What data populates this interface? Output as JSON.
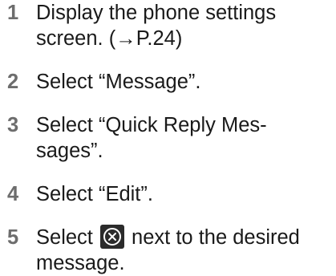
{
  "steps": [
    {
      "number": "1",
      "text_line1": "Display the phone settings",
      "text_line2": "screen. (→P.24)"
    },
    {
      "number": "2",
      "text_line1": "Select “Message”."
    },
    {
      "number": "3",
      "text_line1": "Select “Quick Reply Mes-",
      "text_line2": "sages”."
    },
    {
      "number": "4",
      "text_line1": "Select “Edit”."
    },
    {
      "number": "5",
      "text_before_icon": "Select ",
      "icon": "delete-circle-x-icon",
      "text_after_icon": " next to the desired",
      "text_line2": "message."
    }
  ],
  "colors": {
    "step_number": "#6d6d6d",
    "text": "#1a1a1a",
    "icon_background": "#2b2b2b"
  }
}
